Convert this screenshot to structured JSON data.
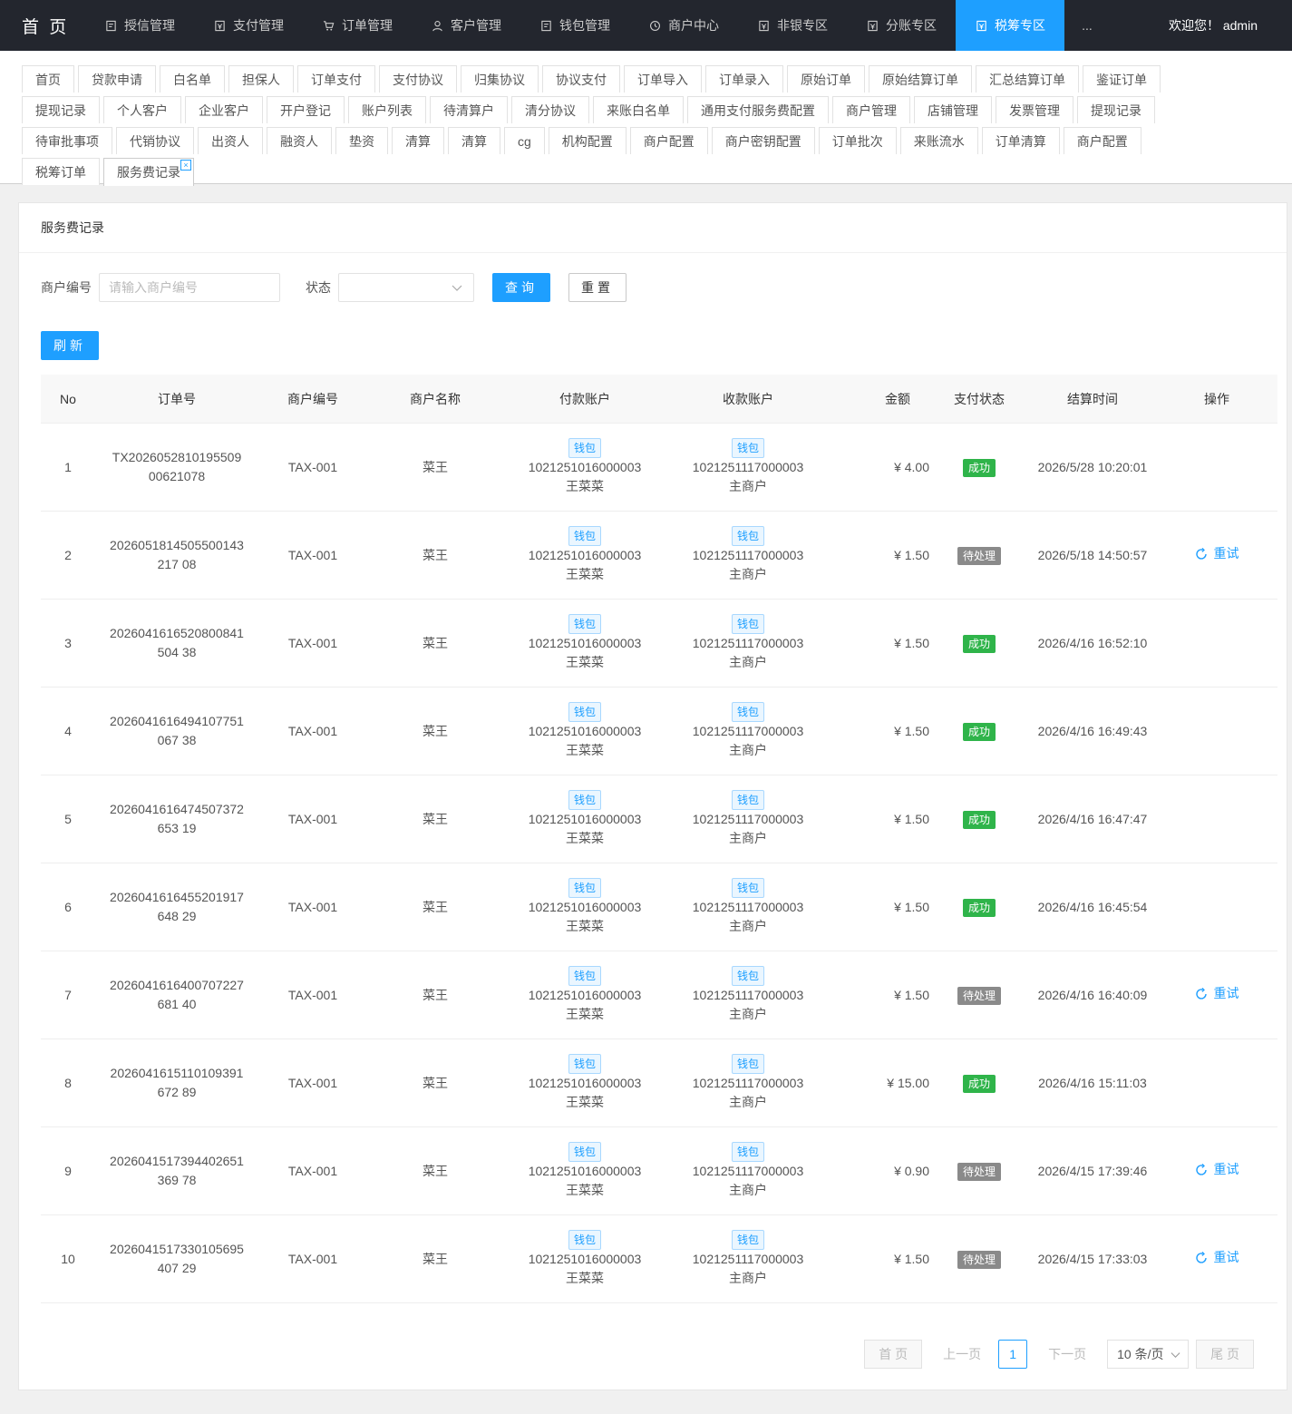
{
  "nav": {
    "brand": "首 页",
    "items": [
      {
        "label": "授信管理",
        "icon": "doc-icon"
      },
      {
        "label": "支付管理",
        "icon": "wallet-icon"
      },
      {
        "label": "订单管理",
        "icon": "cart-icon"
      },
      {
        "label": "客户管理",
        "icon": "user-icon"
      },
      {
        "label": "钱包管理",
        "icon": "doc-icon"
      },
      {
        "label": "商户中心",
        "icon": "clock-icon"
      },
      {
        "label": "非银专区",
        "icon": "wallet-icon"
      },
      {
        "label": "分账专区",
        "icon": "wallet-icon"
      },
      {
        "label": "税筹专区",
        "icon": "wallet-icon",
        "active": true
      }
    ],
    "more": "...",
    "welcome": "欢迎您！ admin"
  },
  "tabs": {
    "row1": [
      "首页",
      "贷款申请",
      "白名单",
      "担保人",
      "订单支付",
      "支付协议",
      "归集协议",
      "协议支付",
      "订单导入",
      "订单录入",
      "原始订单",
      "原始结算订单",
      "汇总结算订单",
      "鉴证订单"
    ],
    "row2": [
      "提现记录",
      "个人客户",
      "企业客户",
      "开户登记",
      "账户列表",
      "待清算户",
      "清分协议",
      "来账白名单",
      "通用支付服务费配置",
      "商户管理",
      "店铺管理",
      "发票管理",
      "提现记录"
    ],
    "row3": [
      "待审批事项",
      "代销协议",
      "出资人",
      "融资人",
      "垫资",
      "清算",
      "清算",
      "cg",
      "机构配置",
      "商户配置",
      "商户密钥配置",
      "订单批次",
      "来账流水",
      "订单清算",
      "商户配置"
    ],
    "row4": [
      "税筹订单",
      "服务费记录"
    ],
    "close_symbol": "×"
  },
  "page": {
    "title": "服务费记录",
    "search": {
      "merchant_label": "商户编号",
      "merchant_placeholder": "请输入商户编号",
      "merchant_value": "",
      "status_label": "状态",
      "status_value": "",
      "query_btn": "查询",
      "reset_btn": "重置"
    },
    "refresh_btn": "刷新"
  },
  "table": {
    "headers": [
      "No",
      "订单号",
      "商户编号",
      "商户名称",
      "付款账户",
      "收款账户",
      "金额",
      "支付状态",
      "结算时间",
      "操作"
    ],
    "wallet_tag": "钱包",
    "retry_label": "重试",
    "rows": [
      {
        "no": "1",
        "order": "TX202605281019550900621078",
        "mno": "TAX-001",
        "mname": "菜王",
        "pay_acct": "1021251016000003",
        "pay_name": "王菜菜",
        "rcv_acct": "1021251117000003",
        "rcv_name": "主商户",
        "amount": "¥ 4.00",
        "status": "成功",
        "status_type": "ok",
        "time": "2026/5/28 10:20:01",
        "retry": false
      },
      {
        "no": "2",
        "order": "2026051814505500143217 08",
        "mno": "TAX-001",
        "mname": "菜王",
        "pay_acct": "1021251016000003",
        "pay_name": "王菜菜",
        "rcv_acct": "1021251117000003",
        "rcv_name": "主商户",
        "amount": "¥ 1.50",
        "status": "待处理",
        "status_type": "pending",
        "time": "2026/5/18 14:50:57",
        "retry": true
      },
      {
        "no": "3",
        "order": "2026041616520800841504 38",
        "mno": "TAX-001",
        "mname": "菜王",
        "pay_acct": "1021251016000003",
        "pay_name": "王菜菜",
        "rcv_acct": "1021251117000003",
        "rcv_name": "主商户",
        "amount": "¥ 1.50",
        "status": "成功",
        "status_type": "ok",
        "time": "2026/4/16 16:52:10",
        "retry": false
      },
      {
        "no": "4",
        "order": "2026041616494107751067 38",
        "mno": "TAX-001",
        "mname": "菜王",
        "pay_acct": "1021251016000003",
        "pay_name": "王菜菜",
        "rcv_acct": "1021251117000003",
        "rcv_name": "主商户",
        "amount": "¥ 1.50",
        "status": "成功",
        "status_type": "ok",
        "time": "2026/4/16 16:49:43",
        "retry": false
      },
      {
        "no": "5",
        "order": "2026041616474507372653 19",
        "mno": "TAX-001",
        "mname": "菜王",
        "pay_acct": "1021251016000003",
        "pay_name": "王菜菜",
        "rcv_acct": "1021251117000003",
        "rcv_name": "主商户",
        "amount": "¥ 1.50",
        "status": "成功",
        "status_type": "ok",
        "time": "2026/4/16 16:47:47",
        "retry": false
      },
      {
        "no": "6",
        "order": "2026041616455201917648 29",
        "mno": "TAX-001",
        "mname": "菜王",
        "pay_acct": "1021251016000003",
        "pay_name": "王菜菜",
        "rcv_acct": "1021251117000003",
        "rcv_name": "主商户",
        "amount": "¥ 1.50",
        "status": "成功",
        "status_type": "ok",
        "time": "2026/4/16 16:45:54",
        "retry": false
      },
      {
        "no": "7",
        "order": "2026041616400707227681 40",
        "mno": "TAX-001",
        "mname": "菜王",
        "pay_acct": "1021251016000003",
        "pay_name": "王菜菜",
        "rcv_acct": "1021251117000003",
        "rcv_name": "主商户",
        "amount": "¥ 1.50",
        "status": "待处理",
        "status_type": "pending",
        "time": "2026/4/16 16:40:09",
        "retry": true
      },
      {
        "no": "8",
        "order": "2026041615110109391672 89",
        "mno": "TAX-001",
        "mname": "菜王",
        "pay_acct": "1021251016000003",
        "pay_name": "王菜菜",
        "rcv_acct": "1021251117000003",
        "rcv_name": "主商户",
        "amount": "¥ 15.00",
        "status": "成功",
        "status_type": "ok",
        "time": "2026/4/16 15:11:03",
        "retry": false
      },
      {
        "no": "9",
        "order": "2026041517394402651369 78",
        "mno": "TAX-001",
        "mname": "菜王",
        "pay_acct": "1021251016000003",
        "pay_name": "王菜菜",
        "rcv_acct": "1021251117000003",
        "rcv_name": "主商户",
        "amount": "¥ 0.90",
        "status": "待处理",
        "status_type": "pending",
        "time": "2026/4/15 17:39:46",
        "retry": true
      },
      {
        "no": "10",
        "order": "2026041517330105695407 29",
        "mno": "TAX-001",
        "mname": "菜王",
        "pay_acct": "1021251016000003",
        "pay_name": "王菜菜",
        "rcv_acct": "1021251117000003",
        "rcv_name": "主商户",
        "amount": "¥ 1.50",
        "status": "待处理",
        "status_type": "pending",
        "time": "2026/4/15 17:33:03",
        "retry": true
      }
    ]
  },
  "pagination": {
    "first": "首 页",
    "prev": "上一页",
    "current": "1",
    "next": "下一页",
    "page_size": "10 条/页",
    "last": "尾 页"
  },
  "colors": {
    "nav_bg": "#23262e",
    "accent": "#1e9fff",
    "success": "#2fb44a",
    "pending": "#8a8a8a"
  }
}
